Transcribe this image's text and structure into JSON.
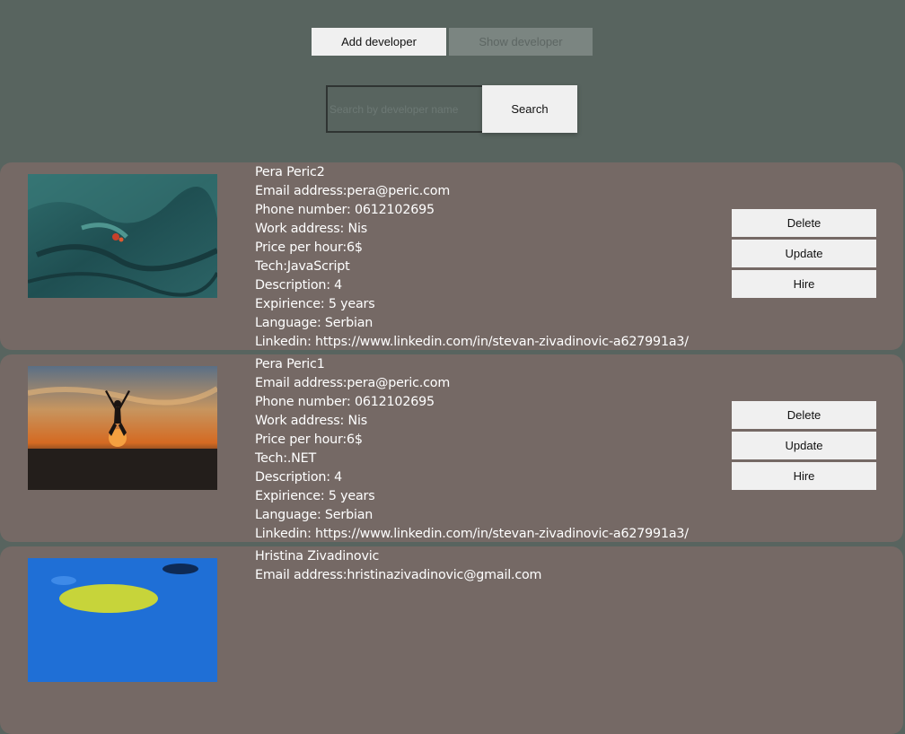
{
  "nav": {
    "add_label": "Add developer",
    "show_label": "Show developer"
  },
  "search": {
    "placeholder": "Search by developer name",
    "button_label": "Search"
  },
  "actions": {
    "delete": "Delete",
    "update": "Update",
    "hire": "Hire"
  },
  "developers": [
    {
      "name": "Pera Peric2",
      "email": "Email address:pera@peric.com",
      "phone": "Phone number: 0612102695",
      "work": "Work address: Nis",
      "price": "Price per hour:6$",
      "tech": "Tech:JavaScript",
      "description": "Description: 4",
      "experience": "Expirience: 5 years",
      "language": "Language: Serbian",
      "linkedin": "Linkedin: https://www.linkedin.com/in/stevan-zivadinovic-a627991a3/"
    },
    {
      "name": "Pera Peric1",
      "email": "Email address:pera@peric.com",
      "phone": "Phone number: 0612102695",
      "work": "Work address: Nis",
      "price": "Price per hour:6$",
      "tech": "Tech:.NET",
      "description": "Description: 4",
      "experience": "Expirience: 5 years",
      "language": "Language: Serbian",
      "linkedin": "Linkedin: https://www.linkedin.com/in/stevan-zivadinovic-a627991a3/"
    },
    {
      "name": "Hristina Zivadinovic",
      "email": "Email address:hristinazivadinovic@gmail.com"
    }
  ]
}
